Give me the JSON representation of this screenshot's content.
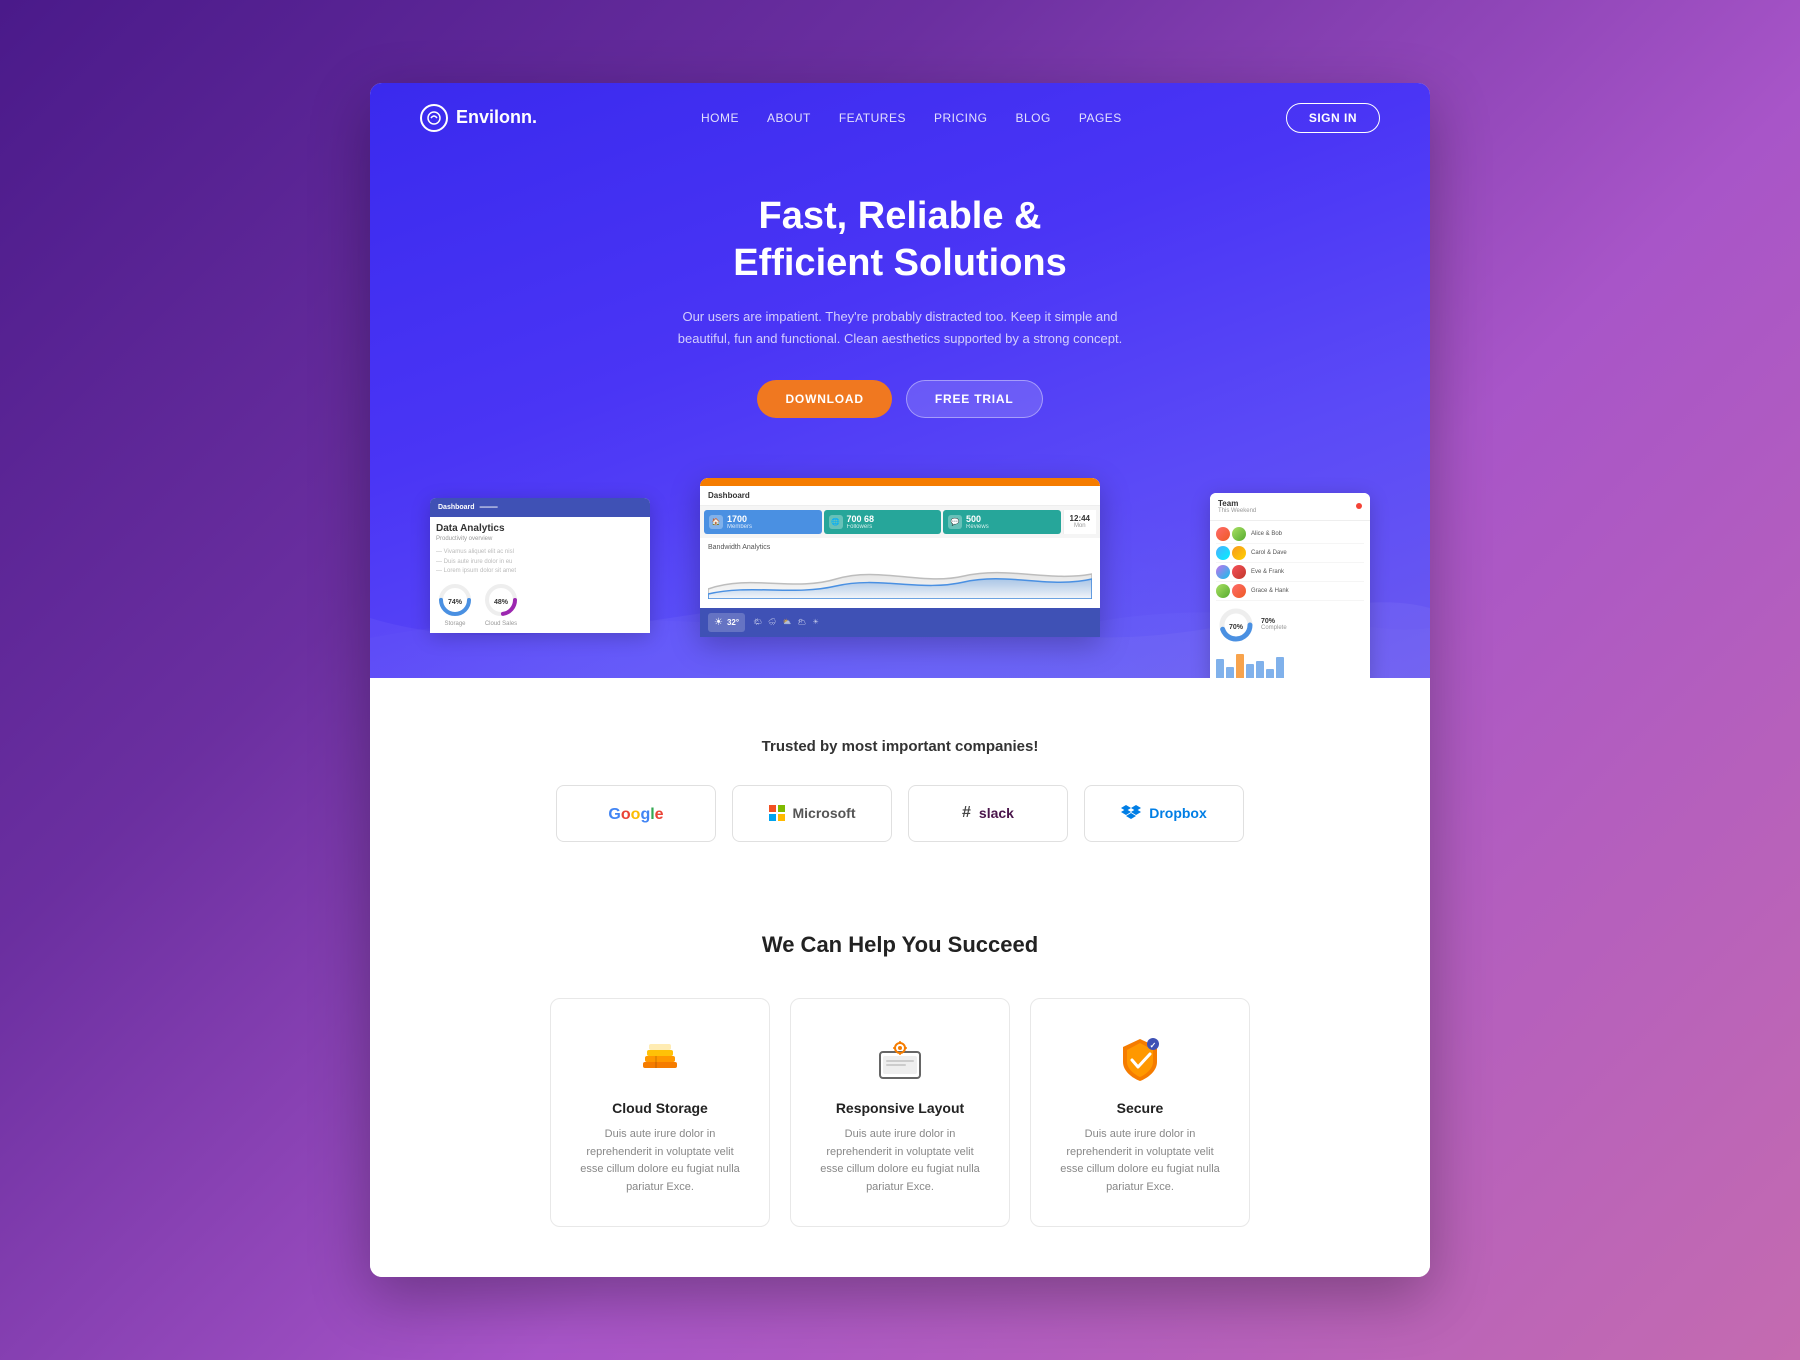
{
  "page": {
    "background": "gradient purple"
  },
  "navbar": {
    "logo_text": "Envilonn.",
    "links": [
      "HOME",
      "ABOUT",
      "FEATURES",
      "PRICING",
      "BLOG",
      "PAGES"
    ],
    "signin_label": "SIGN IN"
  },
  "hero": {
    "title_line1": "Fast, Reliable &",
    "title_line2": "Efficient Solutions",
    "subtitle": "Our users are impatient. They're probably distracted too. Keep it simple and beautiful, fun and functional. Clean aesthetics supported by a strong concept.",
    "btn_download": "DOWNLOAD",
    "btn_trial": "FREE TRIAL"
  },
  "dashboard": {
    "topbar_label": "Dashboard",
    "stats": [
      {
        "icon": "🏠",
        "number": "1700",
        "label": "Members",
        "color": "blue"
      },
      {
        "icon": "🌐",
        "number": "700 68",
        "label": "Followers",
        "color": "teal"
      },
      {
        "icon": "💬",
        "number": "500",
        "label": "Reviews",
        "color": "green"
      }
    ],
    "time": "12:44",
    "chart_label": "Bandwidth Analytics",
    "analytics_title": "Data Analytics",
    "analytics_sub": "Productivity overview",
    "circles": [
      {
        "pct": "74%",
        "label": "Storage"
      },
      {
        "pct": "48%",
        "label": "Cloud Sales"
      }
    ],
    "donut_value": "70%",
    "team_title": "Team",
    "team_sub": "This Weekend"
  },
  "trusted": {
    "title": "Trusted by most important companies!",
    "companies": [
      {
        "name": "Google",
        "color": "#4285F4"
      },
      {
        "name": "Microsoft",
        "color": "#00A4EF"
      },
      {
        "name": "slack",
        "color": "#4A154B"
      },
      {
        "name": "Dropbox",
        "color": "#007EE5"
      }
    ]
  },
  "succeed": {
    "title": "We Can Help You Succeed",
    "features": [
      {
        "icon": "cloud-storage-icon",
        "title": "Cloud Storage",
        "desc": "Duis aute irure dolor in reprehenderit in voluptate velit esse cillum dolore eu fugiat nulla pariatur Exce."
      },
      {
        "icon": "responsive-layout-icon",
        "title": "Responsive Layout",
        "desc": "Duis aute irure dolor in reprehenderit in voluptate velit esse cillum dolore eu fugiat nulla pariatur Exce."
      },
      {
        "icon": "secure-icon",
        "title": "Secure",
        "desc": "Duis aute irure dolor in reprehenderit in voluptate velit esse cillum dolore eu fugiat nulla pariatur Exce."
      }
    ]
  }
}
